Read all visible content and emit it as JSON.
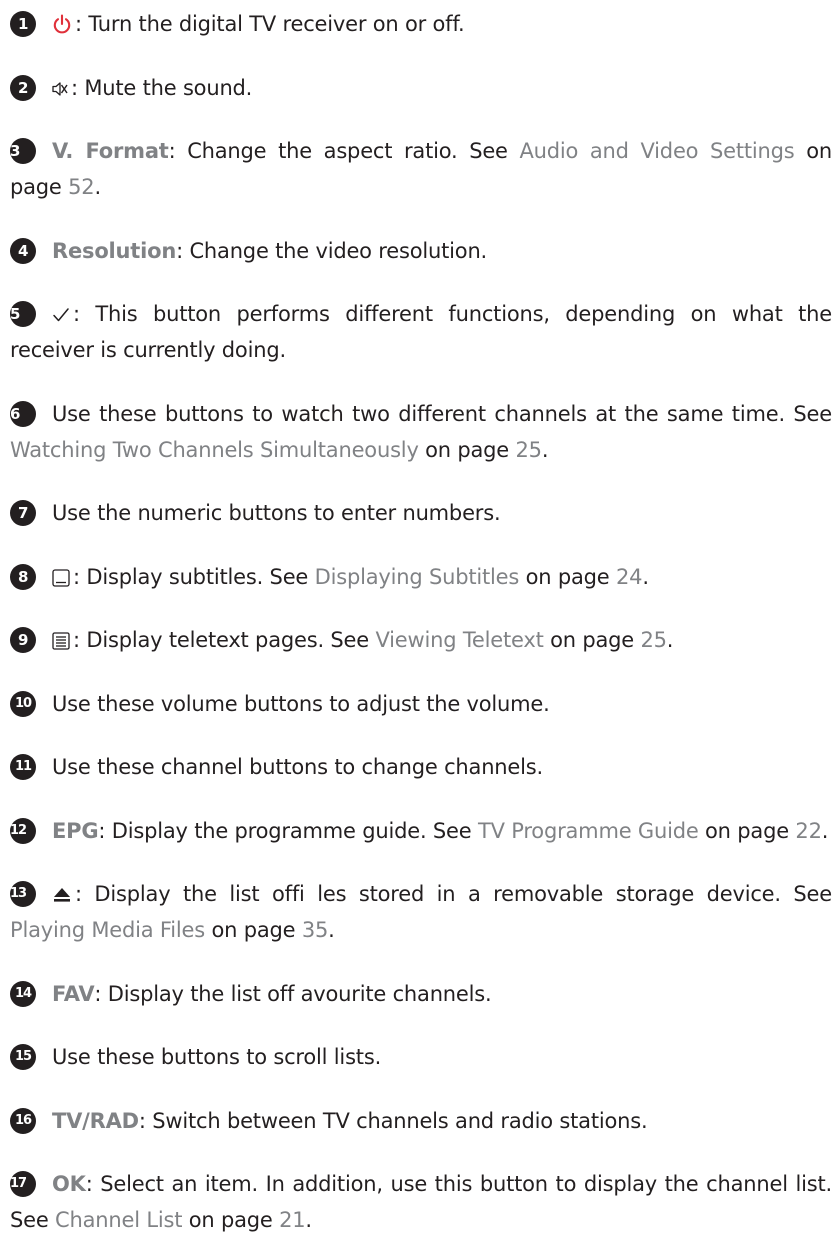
{
  "items": [
    {
      "num": "1",
      "text": ": Turn the digital TV receiver on or off.",
      "icon": "power-icon"
    },
    {
      "num": "2",
      "text": ": Mute the sound.",
      "icon": "mute-icon"
    },
    {
      "num": "3",
      "kw": "V. Format",
      "text_a": ": Change the aspect ratio.  See ",
      "link": "Audio and Video Settings",
      "text_b": " on page ",
      "page": "52",
      "end": "."
    },
    {
      "num": "4",
      "kw": "Resolution",
      "text": ": Change the video resolution."
    },
    {
      "num": "5",
      "text": ": This button performs different functions, depending on what the receiver is currently doing.",
      "icon": "checkmark-icon"
    },
    {
      "num": "6",
      "text_a": "Use these buttons to watch two different channels at the same time. See ",
      "link": "Watching Two Channels Simultaneously",
      "text_b": " on page ",
      "page": "25",
      "end": "."
    },
    {
      "num": "7",
      "text": "Use the numeric buttons to enter numbers."
    },
    {
      "num": "8",
      "text_a": ": Display subtitles. See ",
      "link": "Displaying Subtitles",
      "text_b": " on page ",
      "page": "24",
      "end": ".",
      "icon": "subtitle-icon"
    },
    {
      "num": "9",
      "text_a": ": Display teletext pages. See ",
      "link": "Viewing Teletext",
      "text_b": " on page ",
      "page": "25",
      "end": ".",
      "icon": "teletext-icon"
    },
    {
      "num": "10",
      "text": "Use these volume buttons to adjust the volume."
    },
    {
      "num": "11",
      "text": "Use these channel buttons to change channels."
    },
    {
      "num": "12",
      "kw": "EPG",
      "text_a": ": Display the programme guide. See ",
      "link": "TV Programme Guide",
      "text_b": " on page ",
      "page": "22",
      "end": "."
    },
    {
      "num": "13",
      "text_a": ": Display the list offi les stored in a removable storage device.  See ",
      "link": "Playing Media Files",
      "text_b": " on page ",
      "page": "35",
      "end": ".",
      "icon": "eject-icon"
    },
    {
      "num": "14",
      "kw": "FAV",
      "text": ": Display the list off avourite channels."
    },
    {
      "num": "15",
      "text": "Use these buttons to scroll lists."
    },
    {
      "num": "16",
      "kw": "TV/RAD",
      "text": ": Switch between TV channels and radio stations."
    },
    {
      "num": "17",
      "kw": "OK",
      "text_a": ": Select an item. In addition, use this button to display the channel list. See ",
      "link": "Channel List",
      "text_b": " on page ",
      "page": "21",
      "end": "."
    }
  ],
  "colors": {
    "text": "#231f20",
    "keyword": "#808285",
    "link": "#808285",
    "power_icon": "#e0303a"
  }
}
